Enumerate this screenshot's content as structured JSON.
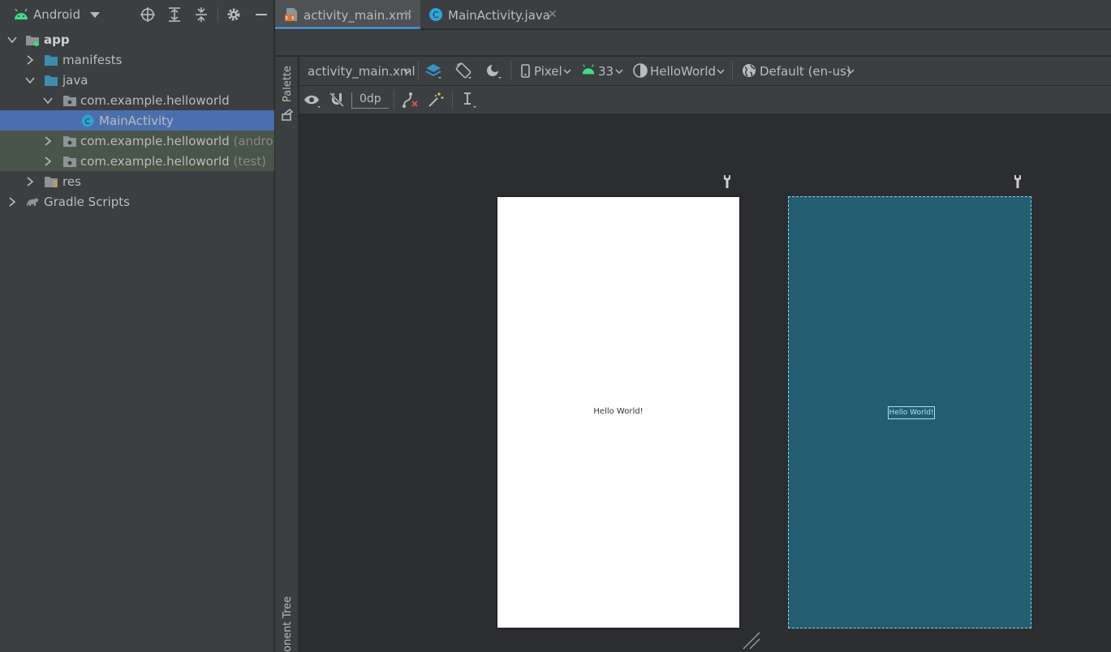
{
  "project_panel": {
    "view_select": "Android",
    "tree": [
      {
        "label": "app",
        "suffix": "",
        "depth": 0,
        "expanded": true,
        "icon": "app-module-icon"
      },
      {
        "label": "manifests",
        "suffix": "",
        "depth": 1,
        "expanded": false,
        "icon": "folder-icon"
      },
      {
        "label": "java",
        "suffix": "",
        "depth": 1,
        "expanded": true,
        "icon": "folder-icon"
      },
      {
        "label": "com.example.helloworld",
        "suffix": "",
        "depth": 2,
        "expanded": true,
        "icon": "package-icon"
      },
      {
        "label": "MainActivity",
        "suffix": "",
        "depth": 3,
        "icon": "class-icon",
        "selected": true
      },
      {
        "label": "com.example.helloworld",
        "suffix": "(androidTe",
        "depth": 2,
        "expanded": false,
        "icon": "package-icon"
      },
      {
        "label": "com.example.helloworld",
        "suffix": "(test)",
        "depth": 2,
        "expanded": false,
        "icon": "package-icon"
      },
      {
        "label": "res",
        "suffix": "",
        "depth": 1,
        "expanded": false,
        "icon": "res-folder-icon"
      },
      {
        "label": "Gradle Scripts",
        "suffix": "",
        "depth": 0,
        "expanded": false,
        "icon": "gradle-icon"
      }
    ]
  },
  "editor_tabs": [
    {
      "label": "activity_main.xml",
      "active": true,
      "icon": "xml-file-icon"
    },
    {
      "label": "MainActivity.java",
      "active": false,
      "icon": "java-class-icon"
    }
  ],
  "close_glyph": "✕",
  "tool_strip": {
    "palette": "Palette",
    "component_tree": "onent Tree"
  },
  "design_toolbar": {
    "file": "activity_main.xml",
    "device": "Pixel",
    "api_level": "33",
    "theme": "HelloWorld",
    "locale": "Default (en-us)"
  },
  "secondary_toolbar": {
    "margin": "0dp"
  },
  "canvas": {
    "design_text": "Hello World!",
    "blueprint_text": "Hello World!"
  },
  "colors": {
    "panel_bg": "#3c3f41",
    "editor_bg": "#2b2d30",
    "selection": "#4b6eaf",
    "test_row": "#49544a",
    "blueprint": "#235d70",
    "blueprint_outline": "#8fd3ea",
    "android_green": "#3ddc84"
  }
}
